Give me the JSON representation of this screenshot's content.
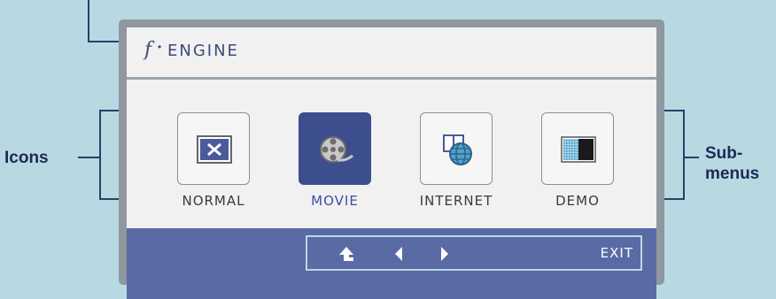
{
  "window": {
    "title": "ENGINE",
    "title_prefix": "f",
    "title_separator": "•"
  },
  "annotations": {
    "left_label": "Icons",
    "right_label_line1": "Sub-",
    "right_label_line2": "menus"
  },
  "modes": [
    {
      "label": "NORMAL",
      "icon": "window-close-icon",
      "selected": false
    },
    {
      "label": "MOVIE",
      "icon": "film-reel-icon",
      "selected": true
    },
    {
      "label": "INTERNET",
      "icon": "globe-window-icon",
      "selected": false
    },
    {
      "label": "DEMO",
      "icon": "demo-split-icon",
      "selected": false
    }
  ],
  "controls": {
    "up_icon": "arrow-up-enter-icon",
    "left_icon": "triangle-left-icon",
    "right_icon": "triangle-right-icon",
    "exit_label": "EXIT"
  },
  "colors": {
    "background": "#b9d9e2",
    "selected_tile": "#3d4e8e",
    "bottom_bar": "#5a6aa5",
    "title_text": "#3e4a7a"
  }
}
